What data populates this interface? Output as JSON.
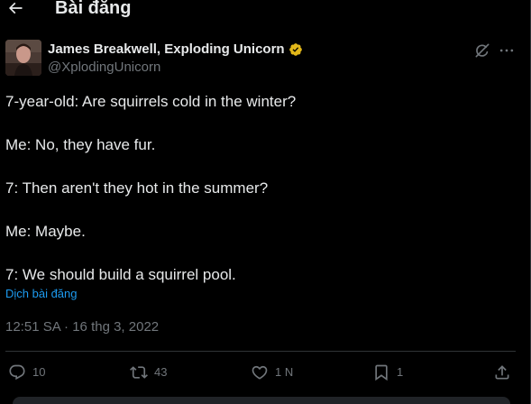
{
  "header": {
    "back_icon": "arrow-left-icon",
    "title": "Bài đăng"
  },
  "tweet": {
    "author": {
      "name": "James Breakwell, Exploding Unicorn",
      "handle": "@XplodingUnicorn",
      "verified_badge_color": "#e2b719",
      "avatar": "profile-photo"
    },
    "top_actions": {
      "grok_icon": "grok-icon",
      "more_icon": "more-horizontal-icon"
    },
    "text_lines": [
      "7-year-old: Are squirrels cold in the winter?",
      "Me: No, they have fur.",
      "7: Then aren't they hot in the summer?",
      "Me: Maybe.",
      "7: We should build a squirrel pool."
    ],
    "translate_label": "Dịch bài đăng",
    "timestamp": "12:51 SA · 16 thg 3, 2022"
  },
  "actions": {
    "reply": {
      "icon": "reply-icon",
      "count": "10"
    },
    "repost": {
      "icon": "repost-icon",
      "count": "43"
    },
    "like": {
      "icon": "heart-icon",
      "count": "1 N"
    },
    "bookmark": {
      "icon": "bookmark-icon",
      "count": "1"
    },
    "share": {
      "icon": "share-icon"
    }
  },
  "colors": {
    "background": "#000000",
    "text_primary": "#e7e9ea",
    "text_secondary": "#71767b",
    "link": "#1d9bf0",
    "border": "#2f3336"
  }
}
